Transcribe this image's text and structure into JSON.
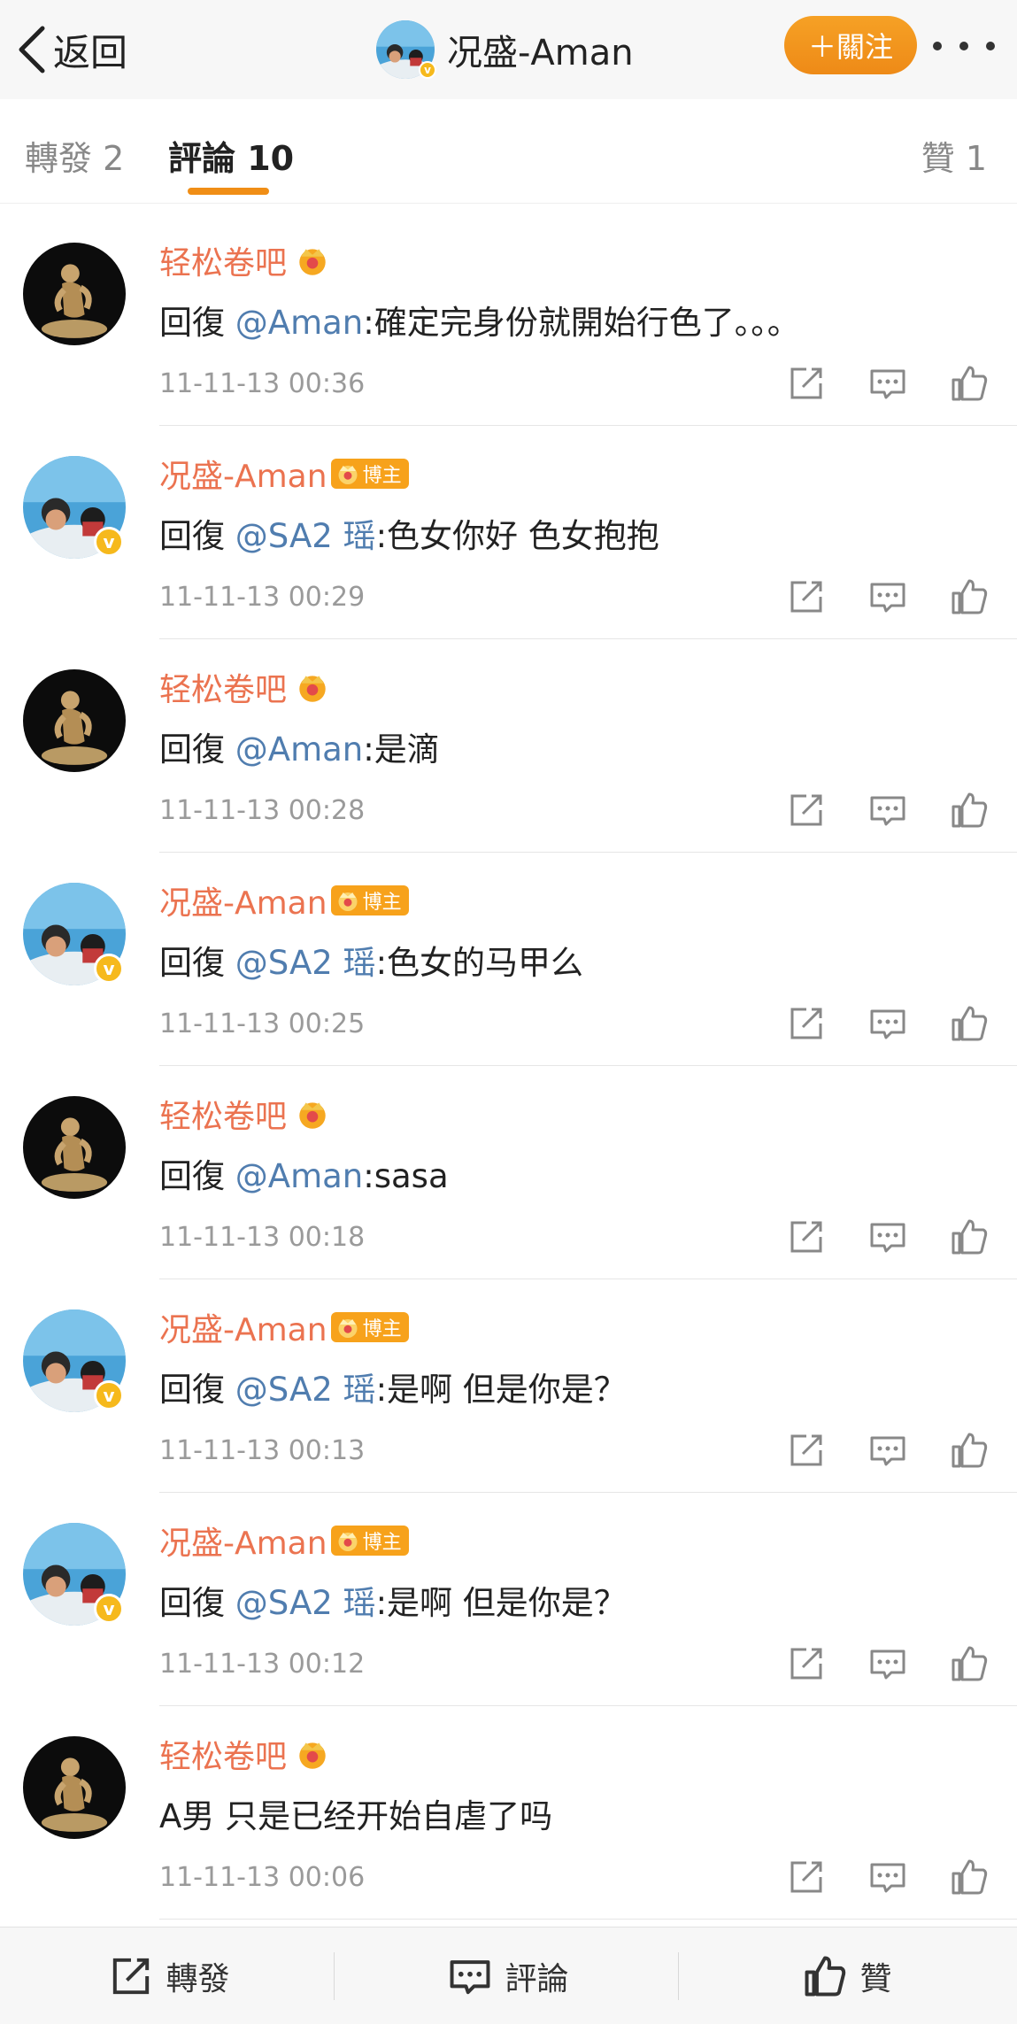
{
  "nav": {
    "back_label": "返回",
    "title": "况盛-Aman",
    "follow_label": "＋關注"
  },
  "tabs": {
    "repost": "轉發 2",
    "comment": "評論 10",
    "like": "贊 1"
  },
  "comments": [
    {
      "user": "轻松卷吧",
      "type": "a",
      "prefix": "回復 ",
      "mention": "@Aman",
      "body": ":確定完身份就開始行色了。。。",
      "time": "11-11-13 00:36"
    },
    {
      "user": "况盛-Aman",
      "type": "b",
      "prefix": "回復 ",
      "mention": "@SA2 瑶",
      "body": ":色女你好  色女抱抱",
      "time": "11-11-13 00:29"
    },
    {
      "user": "轻松卷吧",
      "type": "a",
      "prefix": "回復 ",
      "mention": "@Aman",
      "body": ":是滴",
      "time": "11-11-13 00:28"
    },
    {
      "user": "况盛-Aman",
      "type": "b",
      "prefix": "回復 ",
      "mention": "@SA2 瑶",
      "body": ":色女的马甲么",
      "time": "11-11-13 00:25"
    },
    {
      "user": "轻松卷吧",
      "type": "a",
      "prefix": "回復 ",
      "mention": "@Aman",
      "body": ":sasa",
      "time": "11-11-13 00:18"
    },
    {
      "user": "况盛-Aman",
      "type": "b",
      "prefix": "回復 ",
      "mention": "@SA2 瑶",
      "body": ":是啊  但是你是？",
      "time": "11-11-13 00:13"
    },
    {
      "user": "况盛-Aman",
      "type": "b",
      "prefix": "回復 ",
      "mention": "@SA2 瑶",
      "body": ":是啊  但是你是？",
      "time": "11-11-13 00:12"
    },
    {
      "user": "轻松卷吧",
      "type": "a",
      "prefix": "",
      "mention": "",
      "body": "A男 只是已经开始自虐了吗",
      "time": "11-11-13 00:06"
    }
  ],
  "badges": {
    "boss": "博主"
  },
  "bottom": {
    "repost": "轉發",
    "comment": "評論",
    "like": "贊"
  },
  "colors": {
    "accent": "#f08e16",
    "username": "#eb7350",
    "mention": "#507daf",
    "verified": "#f6b91c"
  }
}
